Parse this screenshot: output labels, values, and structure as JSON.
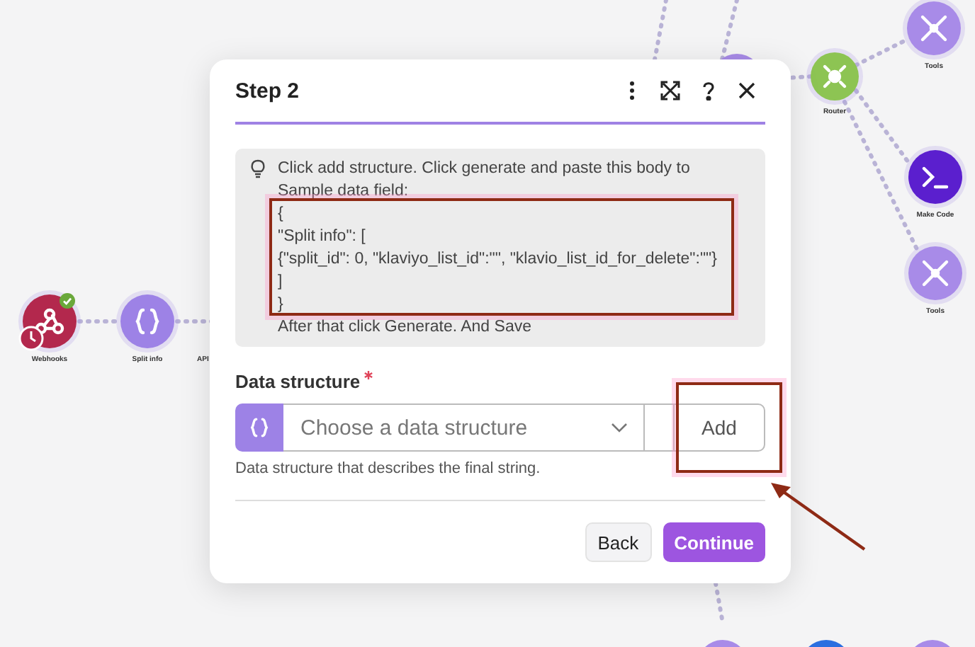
{
  "canvas": {
    "nodes": [
      {
        "kind": "webhook",
        "label": "Webhooks",
        "badge": true
      },
      {
        "kind": "json",
        "label": "Split info",
        "badge": false
      },
      {
        "kind": "router",
        "label": "Router",
        "badge": false
      },
      {
        "kind": "tools",
        "label": "Tools",
        "badge": false
      },
      {
        "kind": "code",
        "label": "Make Code",
        "badge": false
      },
      {
        "kind": "tools",
        "label": "Tools",
        "badge": false
      }
    ],
    "cut_label": "API"
  },
  "dialog": {
    "title": "Step 2",
    "hint": {
      "intro": "Click add structure. Click generate and paste this body to Sample data field:",
      "code_lines": [
        "{",
        "\"Split info\": [",
        "{\"split_id\": 0, \"klaviyo_list_id\":\"\", \"klavio_list_id_for_delete\":\"\"}",
        "]",
        "}"
      ],
      "outro": "After that click Generate. And Save"
    },
    "field": {
      "label": "Data structure",
      "required": true,
      "placeholder": "Choose a data structure",
      "add_button": "Add",
      "help": "Data structure that describes the final string."
    },
    "buttons": {
      "back": "Back",
      "continue": "Continue"
    }
  }
}
